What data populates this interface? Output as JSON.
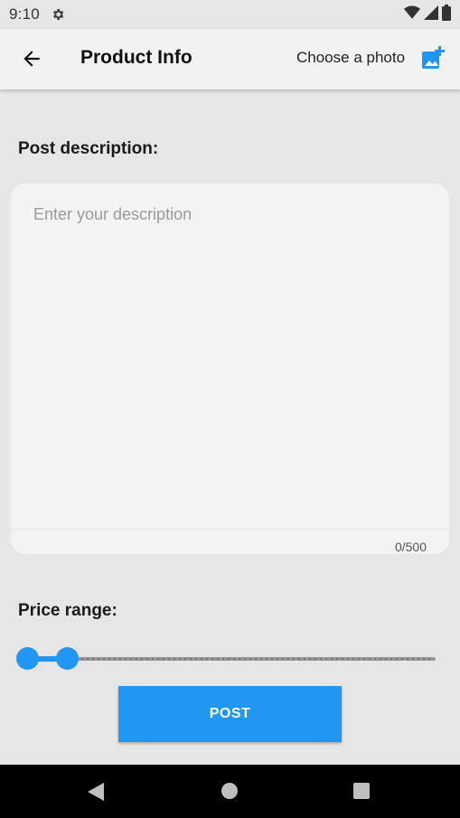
{
  "status_bar": {
    "time": "9:10",
    "icons": [
      "settings-gear-icon",
      "wifi-icon",
      "cell-signal-icon",
      "battery-icon"
    ]
  },
  "app_bar": {
    "back_icon": "arrow-left-icon",
    "title": "Product Info",
    "choose_photo_label": "Choose a photo",
    "add_photo_icon": "add-photo-icon"
  },
  "description": {
    "label": "Post description:",
    "placeholder": "Enter your description",
    "value": "",
    "counter": "0/500"
  },
  "price_range": {
    "label": "Price range:",
    "start_fraction": 0.0,
    "end_fraction": 0.1
  },
  "post_button": {
    "label": "POST"
  },
  "nav_bar": {
    "icons": [
      "nav-back-icon",
      "nav-home-icon",
      "nav-recent-apps-icon"
    ]
  },
  "colors": {
    "accent": "#2196f3",
    "background": "#e6e6e6",
    "app_bar": "#f2f2f2",
    "nav_bar": "#000000"
  }
}
